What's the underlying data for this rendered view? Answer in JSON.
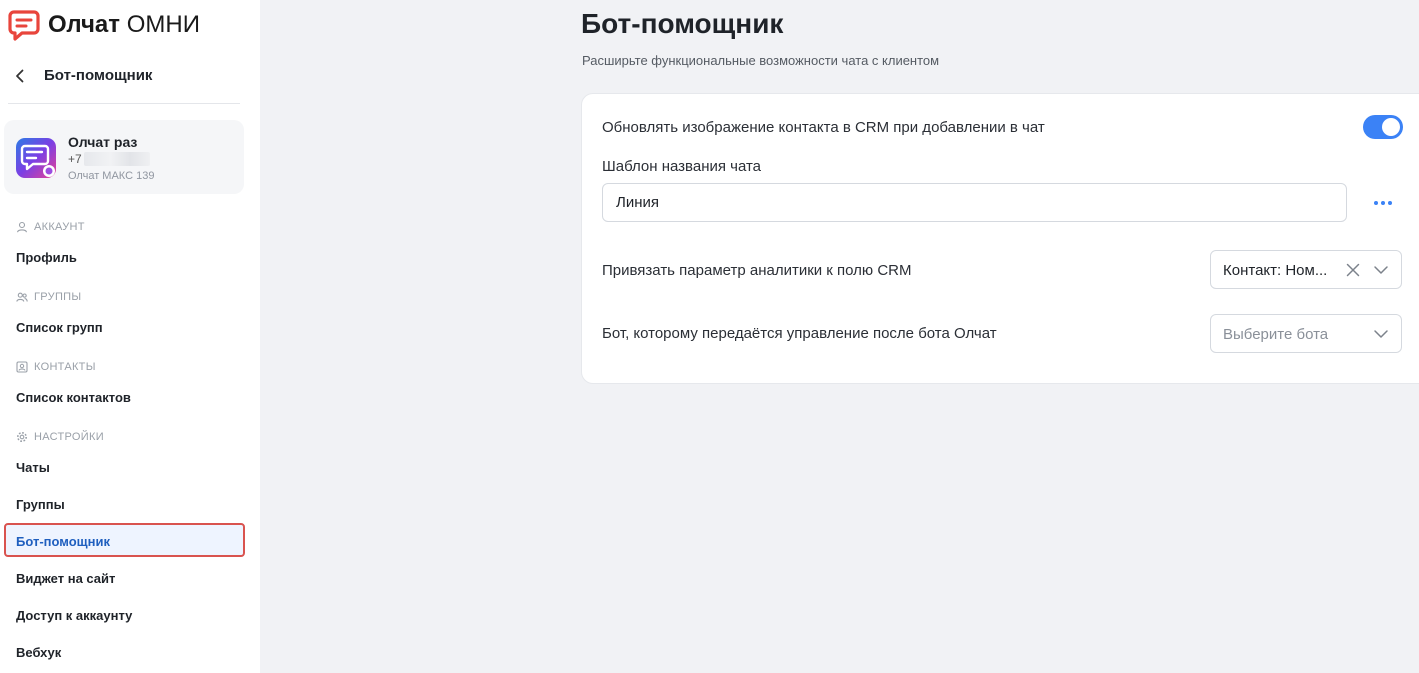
{
  "brand": {
    "name_bold": "Олчат",
    "name_rest": " ОМНИ"
  },
  "sidebar": {
    "back_title": "Бот-помощник",
    "account": {
      "name": "Олчат раз",
      "phone_prefix": "+7",
      "subtitle": "Олчат МАКС 139"
    },
    "sections": {
      "account": {
        "title": "АККАУНТ",
        "items": [
          "Профиль"
        ]
      },
      "groups": {
        "title": "ГРУППЫ",
        "items": [
          "Список групп"
        ]
      },
      "contacts": {
        "title": "КОНТАКТЫ",
        "items": [
          "Список контактов"
        ]
      },
      "settings": {
        "title": "НАСТРОЙКИ",
        "items": [
          "Чаты",
          "Группы",
          "Бот-помощник",
          "Виджет на сайт",
          "Доступ к аккаунту",
          "Вебхук"
        ]
      }
    },
    "active_item": "Бот-помощник"
  },
  "main": {
    "title": "Бот-помощник",
    "subtitle": "Расширьте функциональные возможности чата с клиентом",
    "settings": {
      "update_image_label": "Обновлять изображение контакта в CRM при добавлении в чат",
      "update_image_enabled": true,
      "chat_name_template_label": "Шаблон названия чата",
      "chat_name_template_value": "Линия",
      "analytics_label": "Привязать параметр аналитики к полю CRM",
      "analytics_value": "Контакт: Ном...",
      "handoff_bot_label": "Бот, которому передаётся управление после бота Олчат",
      "handoff_bot_placeholder": "Выберите бота"
    }
  },
  "colors": {
    "accent": "#3b82f6",
    "brand_red": "#e8453c",
    "active_border": "#d9534f"
  },
  "icons": [
    "logo-icon",
    "back-arrow-icon",
    "account-avatar-icon",
    "user-icon",
    "group-icon",
    "contacts-icon",
    "gear-icon",
    "more-dots-icon",
    "clear-x-icon",
    "chevron-down-icon"
  ]
}
